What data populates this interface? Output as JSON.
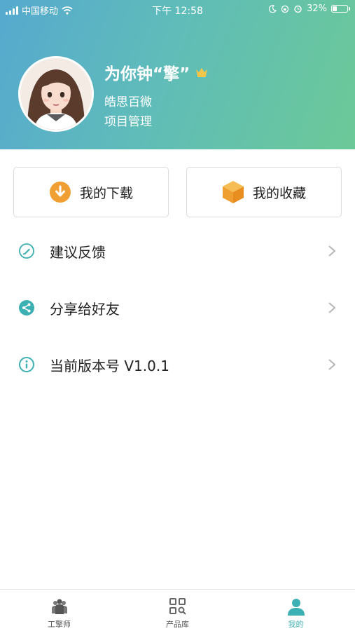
{
  "status_bar": {
    "carrier": "中国移动",
    "time": "下午 12:58",
    "battery": "32%"
  },
  "profile": {
    "name": "为你钟“擎”",
    "company": "皓思百微",
    "role": "项目管理"
  },
  "actions": {
    "downloads_label": "我的下载",
    "favorites_label": "我的收藏"
  },
  "menu": [
    {
      "label": "建议反馈"
    },
    {
      "label": "分享给好友"
    },
    {
      "label": "当前版本号 V1.0.1"
    }
  ],
  "tabbar": [
    {
      "label": "工擎师"
    },
    {
      "label": "产品库"
    },
    {
      "label": "我的"
    }
  ],
  "colors": {
    "accent": "#3db0b3",
    "orange": "#f0a033",
    "header_from": "#56a9cf",
    "header_to": "#6cc997"
  },
  "battery_level": 0.32
}
